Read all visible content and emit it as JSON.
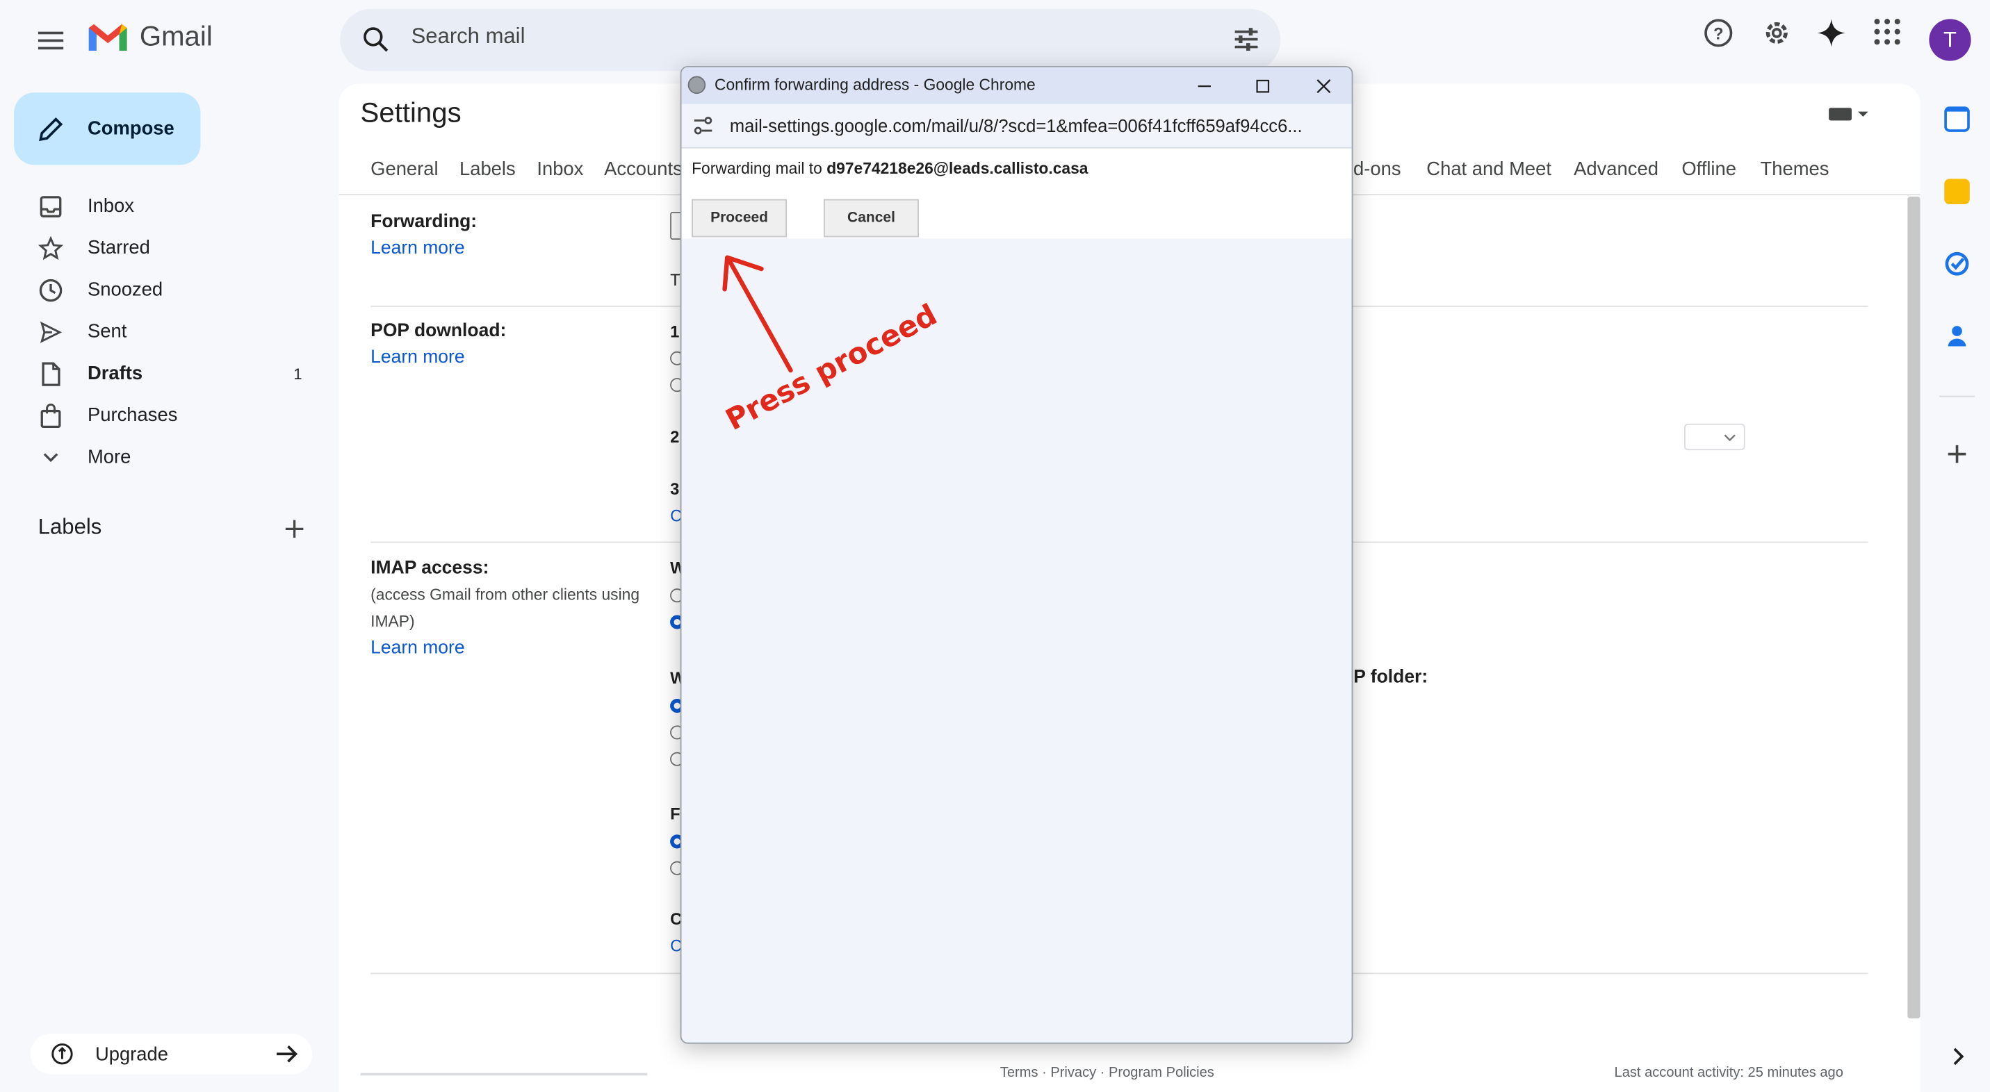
{
  "app": {
    "name": "Gmail"
  },
  "search": {
    "placeholder": "Search mail"
  },
  "avatar": {
    "initial": "T",
    "color": "#6a2fa6"
  },
  "compose": {
    "label": "Compose"
  },
  "nav": [
    {
      "label": "Inbox",
      "icon": "inbox-icon"
    },
    {
      "label": "Starred",
      "icon": "star-icon"
    },
    {
      "label": "Snoozed",
      "icon": "clock-icon"
    },
    {
      "label": "Sent",
      "icon": "send-icon"
    },
    {
      "label": "Drafts",
      "icon": "draft-icon",
      "count": "1"
    },
    {
      "label": "Purchases",
      "icon": "bag-icon"
    },
    {
      "label": "More",
      "icon": "chevron-down-icon"
    }
  ],
  "labels": {
    "title": "Labels"
  },
  "upgrade": {
    "label": "Upgrade"
  },
  "settings": {
    "title": "Settings",
    "tabs": [
      "General",
      "Labels",
      "Inbox",
      "Accounts",
      "dd-ons",
      "Chat and Meet",
      "Advanced",
      "Offline",
      "Themes"
    ],
    "forwarding": {
      "label": "Forwarding:",
      "learn": "Learn more"
    },
    "pop": {
      "label": "POP download:",
      "learn": "Learn more"
    },
    "imap": {
      "label": "IMAP access:",
      "sub": "(access Gmail from other clients using IMAP)",
      "learn": "Learn more",
      "folder_frag": "AP folder:"
    },
    "fragments": {
      "t": "T",
      "one": "1.",
      "two": "2",
      "three": "3",
      "w1": "W",
      "w2": "W",
      "f": "F",
      "c": "C"
    },
    "footer": {
      "links": "Terms · Privacy · Program Policies",
      "activity": "Last account activity: 25 minutes ago"
    }
  },
  "popup": {
    "title": "Confirm forwarding address - Google Chrome",
    "url": "mail-settings.google.com/mail/u/8/?scd=1&mfea=006f41fcff659af94cc6...",
    "message_prefix": "Forwarding mail to ",
    "email": "d97e74218e26@leads.callisto.casa",
    "proceed": "Proceed",
    "cancel": "Cancel"
  },
  "annotation": {
    "text": "Press proceed",
    "color": "#e0281b"
  },
  "colors": {
    "accent": "#0b57d0",
    "compose_bg": "#c2e7ff",
    "page_bg": "#f6f8fc",
    "search_bg": "#e9eef6"
  }
}
